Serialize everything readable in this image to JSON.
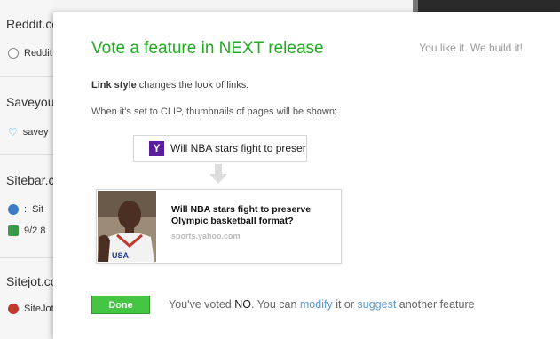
{
  "sidebar": {
    "groups": [
      {
        "title": "Reddit.com",
        "items": [
          {
            "label": "Reddit",
            "icon": "reddit-alien-icon"
          }
        ]
      },
      {
        "title": "Saveyourl",
        "items": [
          {
            "label": "savey",
            "icon": "heart-icon"
          }
        ]
      },
      {
        "title": "Sitebar.com",
        "items": [
          {
            "label": ":: Sit",
            "icon": "globe-icon"
          },
          {
            "label": "9/2 8",
            "icon": "puzzle-icon"
          }
        ]
      },
      {
        "title": "Sitejot.com",
        "items": [
          {
            "label": "SiteJot",
            "icon": "sitejot-icon"
          }
        ]
      }
    ]
  },
  "dialog": {
    "title": "Vote a feature in NEXT release",
    "tagline": "You like it. We build it!",
    "desc_bold": "Link style",
    "desc_rest": " changes the look of links.",
    "desc2": "When it's set to CLIP, thumbnails of pages will be shown:",
    "link_example": {
      "logo": "Y",
      "text": "Will NBA stars fight to preser"
    },
    "clip_example": {
      "title": "Will NBA stars fight to preserve Olympic basketball format?",
      "source": "sports.yahoo.com",
      "jersey": "USA"
    },
    "done_label": "Done",
    "status": {
      "prefix": "You've voted ",
      "vote": "NO",
      "middle": ". You can ",
      "modify": "modify",
      "or": " it or ",
      "suggest": "suggest",
      "suffix": " another feature"
    }
  }
}
